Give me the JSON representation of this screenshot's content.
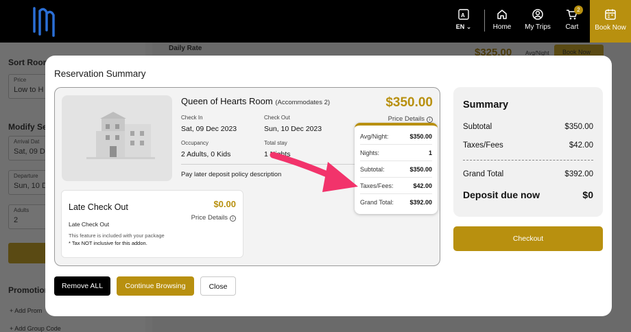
{
  "nav": {
    "language": "EN",
    "home": "Home",
    "my_trips": "My Trips",
    "cart": "Cart",
    "cart_count": "2",
    "book_now": "Book Now"
  },
  "background": {
    "daily_rate": "Daily Rate",
    "daily_price": "$325.00",
    "daily_unit": "Avg/Night",
    "book_now": "Book Now",
    "sort_rooms": "Sort Room",
    "price_label": "Price",
    "price_value": "Low to H",
    "modify_search": "Modify Se",
    "arrival_label": "Arrival Dat",
    "arrival_value": "Sat, 09 D",
    "departure_label": "Departure",
    "departure_value": "Sun, 10 D",
    "adults_label": "Adults",
    "adults_value": "2",
    "promotions": "Promotion",
    "add_promo": "+ Add Prom",
    "add_group": "+ Add Group Code"
  },
  "modal": {
    "title": "Reservation Summary",
    "room": {
      "name": "Queen of Hearts Room",
      "accommodates": "(Accommodates 2)",
      "price": "$350.00",
      "price_details": "Price Details",
      "check_in_label": "Check In",
      "check_in": "Sat, 09 Dec 2023",
      "check_out_label": "Check Out",
      "check_out": "Sun, 10 Dec 2023",
      "occupancy_label": "Occupancy",
      "occupancy": "2 Adults, 0 Kids",
      "total_stay_label": "Total stay",
      "total_stay": "1 Nights",
      "policy": "Pay later deposit policy description"
    },
    "price_popover": [
      {
        "label": "Avg/Night:",
        "value": "$350.00"
      },
      {
        "label": "Nights:",
        "value": "1"
      },
      {
        "label": "Subtotal:",
        "value": "$350.00"
      },
      {
        "label": "Taxes/Fees:",
        "value": "$42.00"
      },
      {
        "label": "Grand Total:",
        "value": "$392.00"
      }
    ],
    "addon": {
      "title": "Late Check Out",
      "price": "$0.00",
      "price_details": "Price Details",
      "subtitle": "Late Check Out",
      "note": "This feature is included with your package",
      "tax_note": "* Tax NOT inclusive for this addon."
    },
    "buttons": {
      "remove_all": "Remove ALL",
      "continue": "Continue Browsing",
      "close": "Close"
    },
    "summary": {
      "title": "Summary",
      "subtotal_label": "Subtotal",
      "subtotal": "$350.00",
      "taxes_label": "Taxes/Fees",
      "taxes": "$42.00",
      "grand_total_label": "Grand Total",
      "grand_total": "$392.00",
      "deposit_label": "Deposit due now",
      "deposit": "$0",
      "checkout": "Checkout"
    }
  },
  "colors": {
    "gold": "#b8900f",
    "annotation_arrow": "#f2336b"
  }
}
